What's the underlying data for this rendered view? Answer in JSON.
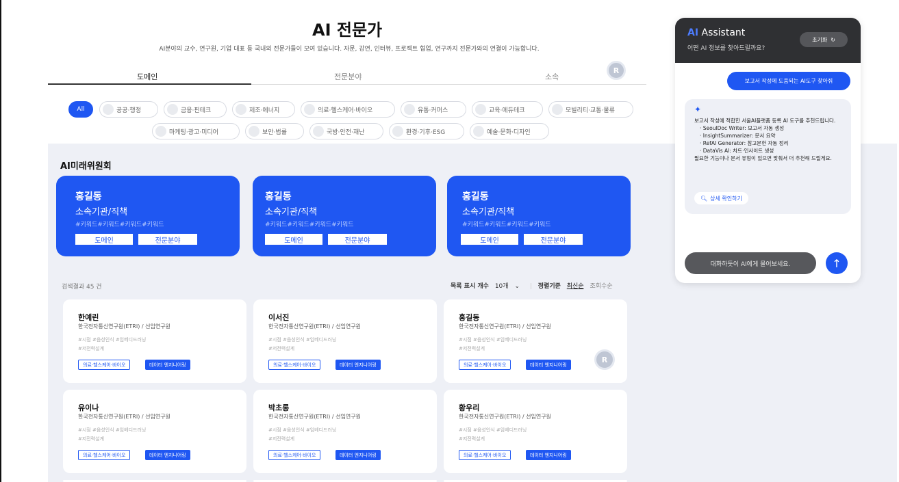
{
  "header": {
    "title": "AI 전문가",
    "subtitle": "AI분야의 교수, 연구원, 기업 대표 등 국내외 전문가들이 모여 있습니다. 자문, 강연, 인터뷰, 프로젝트 협업, 연구까지 전문가와의 연결이 가능합니다."
  },
  "tabs": [
    "도메인",
    "전문분야",
    "소속"
  ],
  "active_tab": "도메인",
  "avatar_initial": "R",
  "chips_row1": [
    "All",
    "공공·행정",
    "금융·핀테크",
    "제조·에너지",
    "의료·헬스케어·바이오",
    "유통·커머스",
    "교육·에듀테크",
    "모빌리티·교통·물류"
  ],
  "chips_row2": [
    "마케팅·광고·미디어",
    "보안·법률",
    "국방·안전·재난",
    "환경·기후·ESG",
    "예술·문화·디자인"
  ],
  "section": {
    "title": "AI미래위원회"
  },
  "featured": [
    {
      "name": "홍길동",
      "org": "소속기관/직책",
      "keywords": "#키워드#키워드#키워드#키워드",
      "btn1": "도메인",
      "btn2": "전문분야"
    },
    {
      "name": "홍길동",
      "org": "소속기관/직책",
      "keywords": "#키워드#키워드#키워드#키워드",
      "btn1": "도메인",
      "btn2": "전문분야"
    },
    {
      "name": "홍길동",
      "org": "소속기관/직책",
      "keywords": "#키워드#키워드#키워드#키워드",
      "btn1": "도메인",
      "btn2": "전문분야"
    }
  ],
  "results": {
    "count_label": "검색결과 45 건",
    "page_size_label": "목록 표시 개수",
    "page_size_value": "10개",
    "sort_label": "정렬기준",
    "sort_active": "최신순",
    "sort_other": "조회수순"
  },
  "cards": [
    {
      "name": "한예린",
      "org": "한국전자통신연구원(ETRI) / 선임연구원",
      "kw1": "#시점  #음성인식  #임베디드러닝",
      "kw2": "#저전력설계",
      "tag1": "의료·헬스케어·바이오",
      "tag2": "데이터 엔지니어링"
    },
    {
      "name": "이서진",
      "org": "한국전자통신연구원(ETRI) / 선임연구원",
      "kw1": "#시점  #음성인식  #임베디드러닝",
      "kw2": "#저전력설계",
      "tag1": "의료·헬스케어·바이오",
      "tag2": "데이터 엔지니어링"
    },
    {
      "name": "홍길동",
      "org": "한국전자통신연구원(ETRI) / 선임연구원",
      "kw1": "#시점  #음성인식  #임베디드러닝",
      "kw2": "#저전력설계",
      "tag1": "의료·헬스케어·바이오",
      "tag2": "데이터 엔지니어링"
    },
    {
      "name": "유이나",
      "org": "한국전자통신연구원(ETRI) / 선임연구원",
      "kw1": "#시점  #음성인식  #임베디드러닝",
      "kw2": "#저전력설계",
      "tag1": "의료·헬스케어·바이오",
      "tag2": "데이터 엔지니어링"
    },
    {
      "name": "박초롱",
      "org": "한국전자통신연구원(ETRI) / 선임연구원",
      "kw1": "#시점  #음성인식  #임베디드러닝",
      "kw2": "#저전력설계",
      "tag1": "의료·헬스케어·바이오",
      "tag2": "데이터 엔지니어링"
    },
    {
      "name": "황우리",
      "org": "한국전자통신연구원(ETRI) / 선임연구원",
      "kw1": "#시점  #음성인식  #임베디드러닝",
      "kw2": "#저전력설계",
      "tag1": "의료·헬스케어·바이오",
      "tag2": "데이터 엔지니어링"
    }
  ],
  "assistant": {
    "title_ai": "AI",
    "title_rest": " Assistant",
    "subtitle": "어떤 AI 정보를 찾아드릴까요?",
    "reset_label": "초기화",
    "user_message": "보고서 작성에 도움되는 AI도구 찾아줘",
    "bot_intro": "보고서 작성에 적합한 서울AI플랫폼 등록 AI 도구를 추천드립니다.",
    "bot_items": [
      "SeoulDoc Writer: 보고서 자동 생성",
      "InsightSummarizer: 문서 요약",
      "RefAI Generator: 참고문헌 자동 정리",
      "DataVis AI: 차트·인사이트 생성"
    ],
    "bot_outro": "필요한 기능이나 문서 유형이 있으면 맞춰서 더 추천해 드릴게요.",
    "detail_label": "상세 확인하기",
    "input_placeholder": "대화하듯이 AI에게 물어보세요.",
    "icons": {
      "reset": "refresh-icon",
      "sparkle": "sparkle-icon",
      "search": "search-icon",
      "send": "arrow-up-icon"
    }
  },
  "colors": {
    "primary": "#1f57f2",
    "panel_dark": "#2f3033",
    "gray_bg": "#eef0f6"
  }
}
